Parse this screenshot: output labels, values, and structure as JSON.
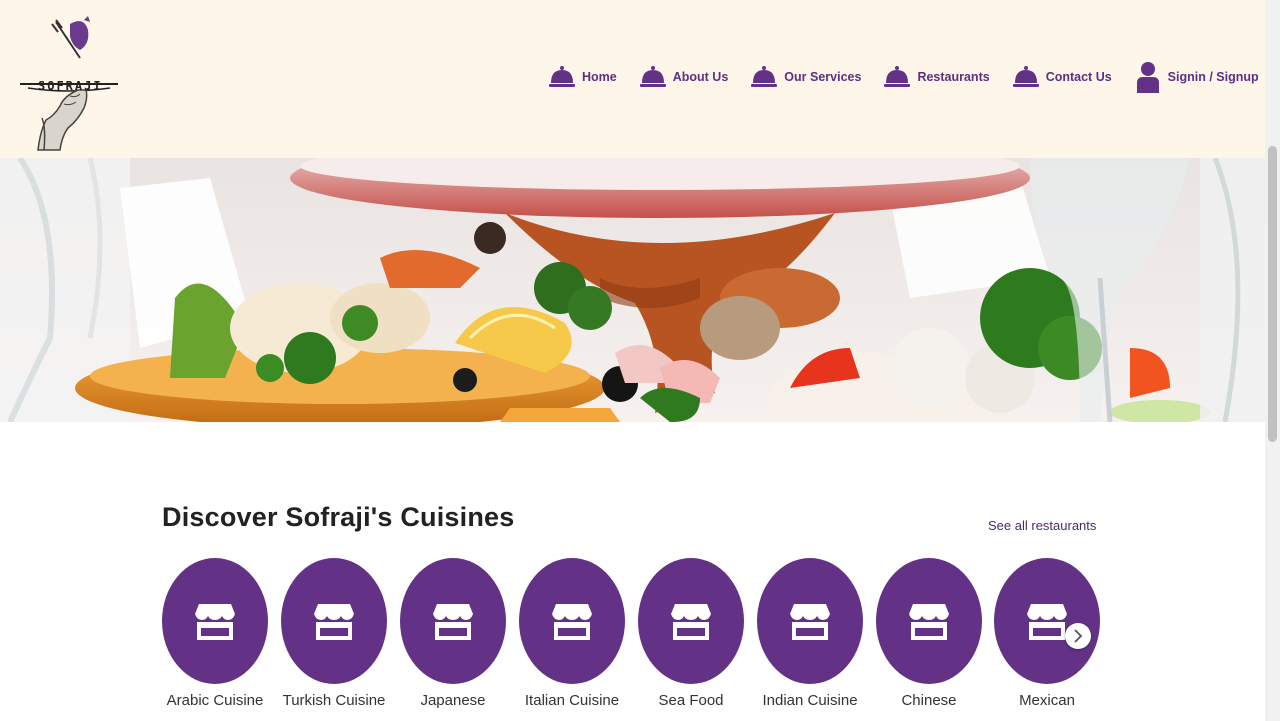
{
  "brand": {
    "name": "SOFRAJI"
  },
  "nav": {
    "items": [
      {
        "label": "Home",
        "icon": "cloche-icon"
      },
      {
        "label": "About Us",
        "icon": "cloche-icon"
      },
      {
        "label": "Our Services",
        "icon": "cloche-icon"
      },
      {
        "label": "Restaurants",
        "icon": "cloche-icon"
      },
      {
        "label": "Contact Us",
        "icon": "cloche-icon"
      },
      {
        "label": "Signin / Signup",
        "icon": "user-icon"
      }
    ]
  },
  "section": {
    "title": "Discover Sofraji's Cuisines",
    "see_all_label": "See all restaurants"
  },
  "cuisines": [
    {
      "label": "Arabic Cuisine",
      "icon": "storefront-icon"
    },
    {
      "label": "Turkish Cuisine",
      "icon": "storefront-icon"
    },
    {
      "label": "Japanese",
      "icon": "storefront-icon"
    },
    {
      "label": "Italian Cuisine",
      "icon": "storefront-icon"
    },
    {
      "label": "Sea Food",
      "icon": "storefront-icon"
    },
    {
      "label": "Indian Cuisine",
      "icon": "storefront-icon"
    },
    {
      "label": "Chinese",
      "icon": "storefront-icon"
    },
    {
      "label": "Mexican",
      "icon": "storefront-icon"
    }
  ],
  "colors": {
    "brand_purple": "#633286",
    "nav_text": "#5e2f82",
    "header_bg": "#fef6e9"
  }
}
